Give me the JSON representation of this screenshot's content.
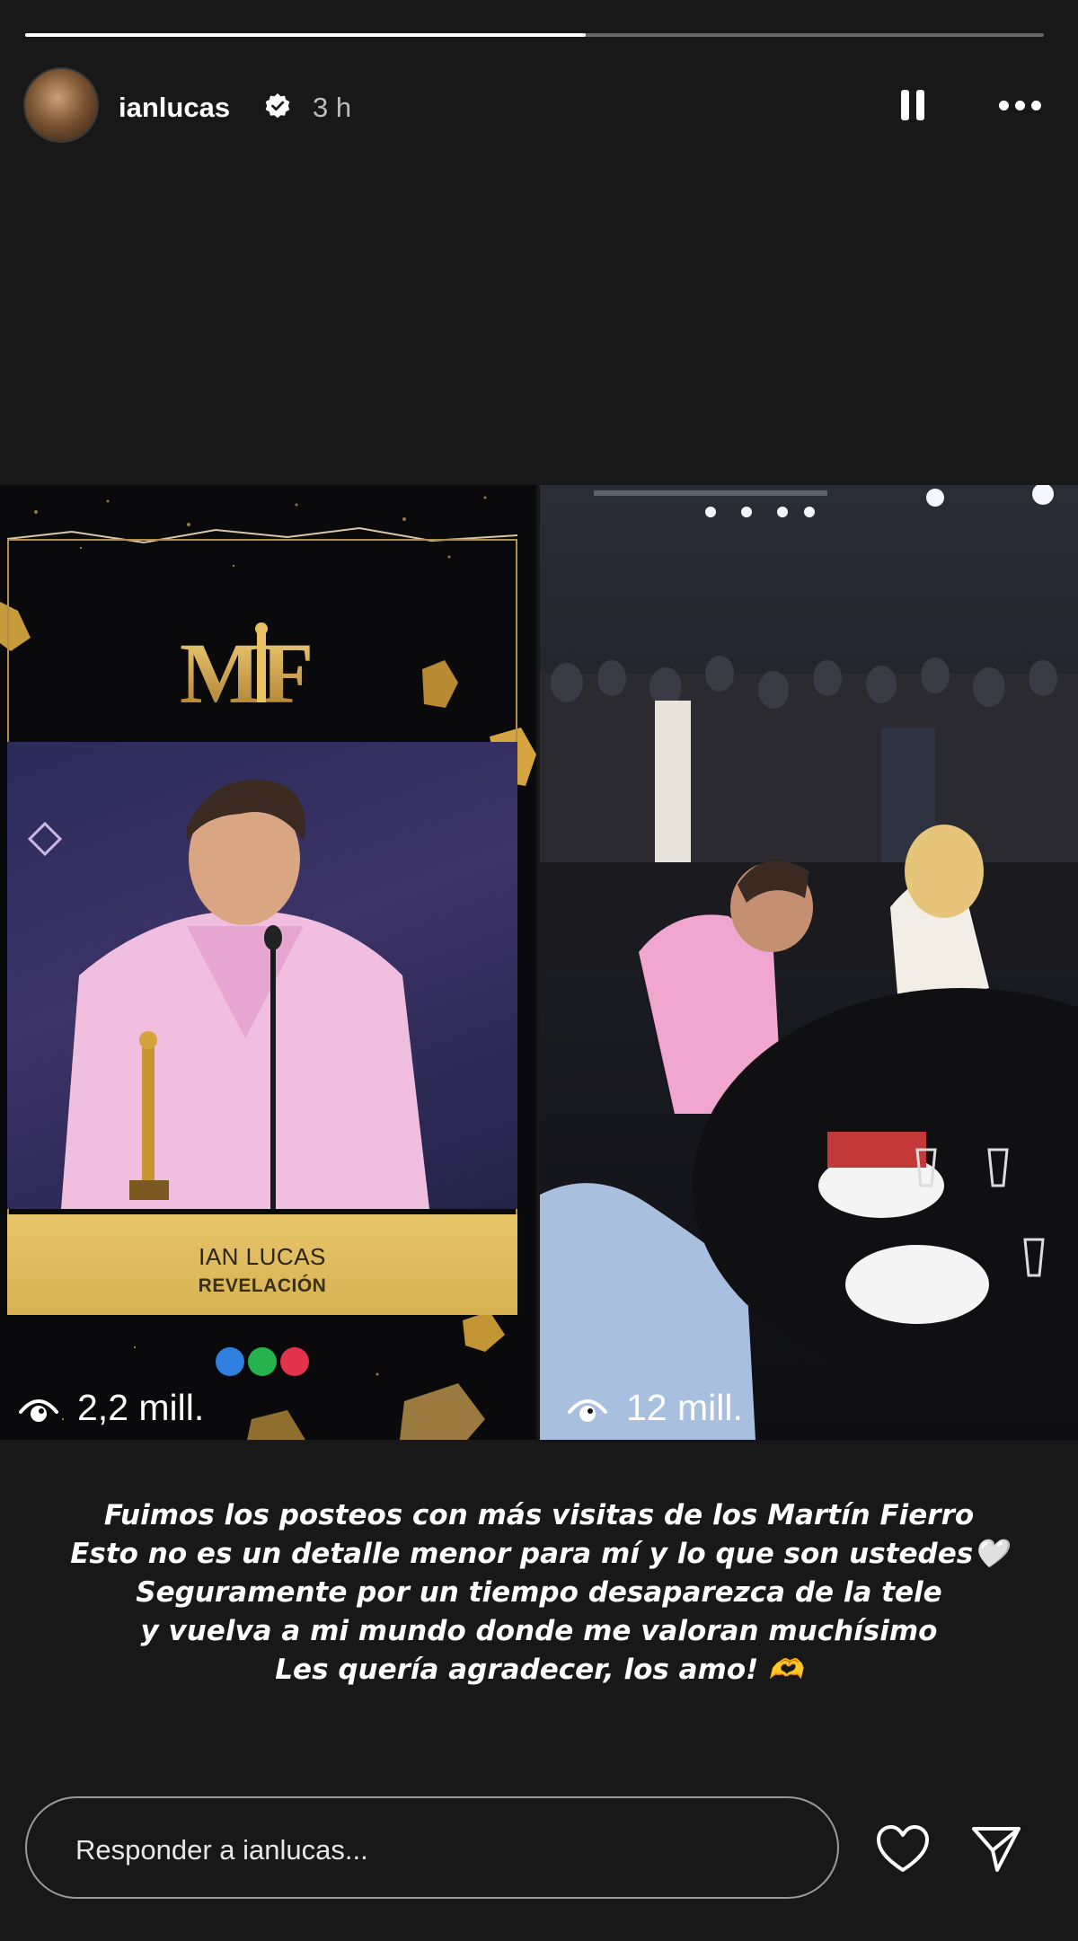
{
  "story": {
    "progress": 0.55
  },
  "header": {
    "username": "ianlucas",
    "time": "3 h",
    "avatar_icon": "profile-avatar",
    "verified_icon": "verified-badge-icon",
    "pause_icon": "pause-icon",
    "more_icon": "more-icon"
  },
  "left_panel": {
    "logo_text": "MF",
    "nameplate_name": "IAN LUCAS",
    "nameplate_award": "REVELACIÓN",
    "views": "2,2 mill.",
    "accent": "#d7b252"
  },
  "right_panel": {
    "views": "12 mill."
  },
  "caption": {
    "lines": [
      "Fuimos los posteos con más visitas de los Martín Fierro",
      "Esto no es un detalle menor para mí y lo que son ustedes🤍",
      "Seguramente por un tiempo desaparezca de la tele",
      "y vuelva a mi mundo donde me valoran muchísimo",
      "Les quería agradecer, los amo! 🫶"
    ]
  },
  "reply": {
    "placeholder": "Responder a ianlucas..."
  },
  "icons": {
    "eye": "eye-icon",
    "heart": "heart-icon",
    "send": "send-icon"
  }
}
